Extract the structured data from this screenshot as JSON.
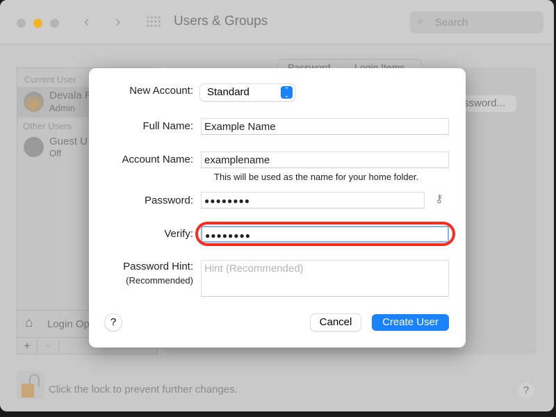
{
  "window": {
    "title": "Users & Groups",
    "search_placeholder": "Search"
  },
  "sidebar": {
    "current_user_header": "Current User",
    "current_user_name": "Devala R",
    "current_user_role": "Admin",
    "other_users_header": "Other Users",
    "guest_name": "Guest U",
    "guest_status": "Off",
    "login_options": "Login Op",
    "add": "+",
    "remove": "−"
  },
  "panel": {
    "tabs": [
      "Password",
      "Login Items"
    ],
    "change_password": "ssword..."
  },
  "footer": {
    "lock_text": "Click the lock to prevent further changes.",
    "help": "?"
  },
  "dialog": {
    "new_account_label": "New Account:",
    "new_account_value": "Standard",
    "full_name_label": "Full Name:",
    "full_name_value": "Example Name",
    "account_name_label": "Account Name:",
    "account_name_value": "examplename",
    "account_name_note": "This will be used as the name for your home folder.",
    "password_label": "Password:",
    "password_value": "●●●●●●●●",
    "verify_label": "Verify:",
    "verify_value": "●●●●●●●●",
    "hint_label": "Password Hint:",
    "hint_sublabel": "(Recommended)",
    "hint_placeholder": "Hint (Recommended)",
    "help": "?",
    "cancel": "Cancel",
    "create": "Create User"
  },
  "colors": {
    "accent": "#1a82fb",
    "highlight": "#ff2a1a"
  }
}
